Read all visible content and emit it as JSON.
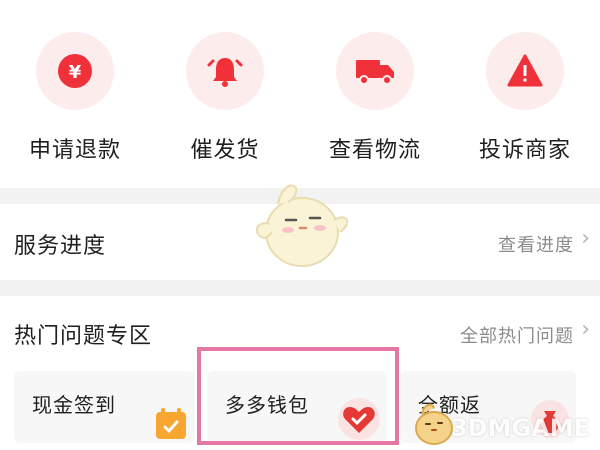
{
  "quick_actions": [
    {
      "label": "申请退款",
      "icon": "yen-icon"
    },
    {
      "label": "催发货",
      "icon": "bell-icon"
    },
    {
      "label": "查看物流",
      "icon": "truck-icon"
    },
    {
      "label": "投诉商家",
      "icon": "warning-icon"
    }
  ],
  "service": {
    "title": "服务进度",
    "link": "查看进度"
  },
  "hot": {
    "title": "热门问题专区",
    "link": "全部热门问题",
    "tiles": [
      {
        "label": "现金签到",
        "icon": "calendar-check-icon"
      },
      {
        "label": "多多钱包",
        "icon": "heart-check-icon"
      },
      {
        "label": "全额返",
        "icon": "money-bag-icon"
      }
    ]
  },
  "watermark": "3DMGAME",
  "colors": {
    "accent": "#f0313a",
    "icon_bg": "#fdecec",
    "highlight": "#e478a5",
    "orange": "#f7a631"
  }
}
